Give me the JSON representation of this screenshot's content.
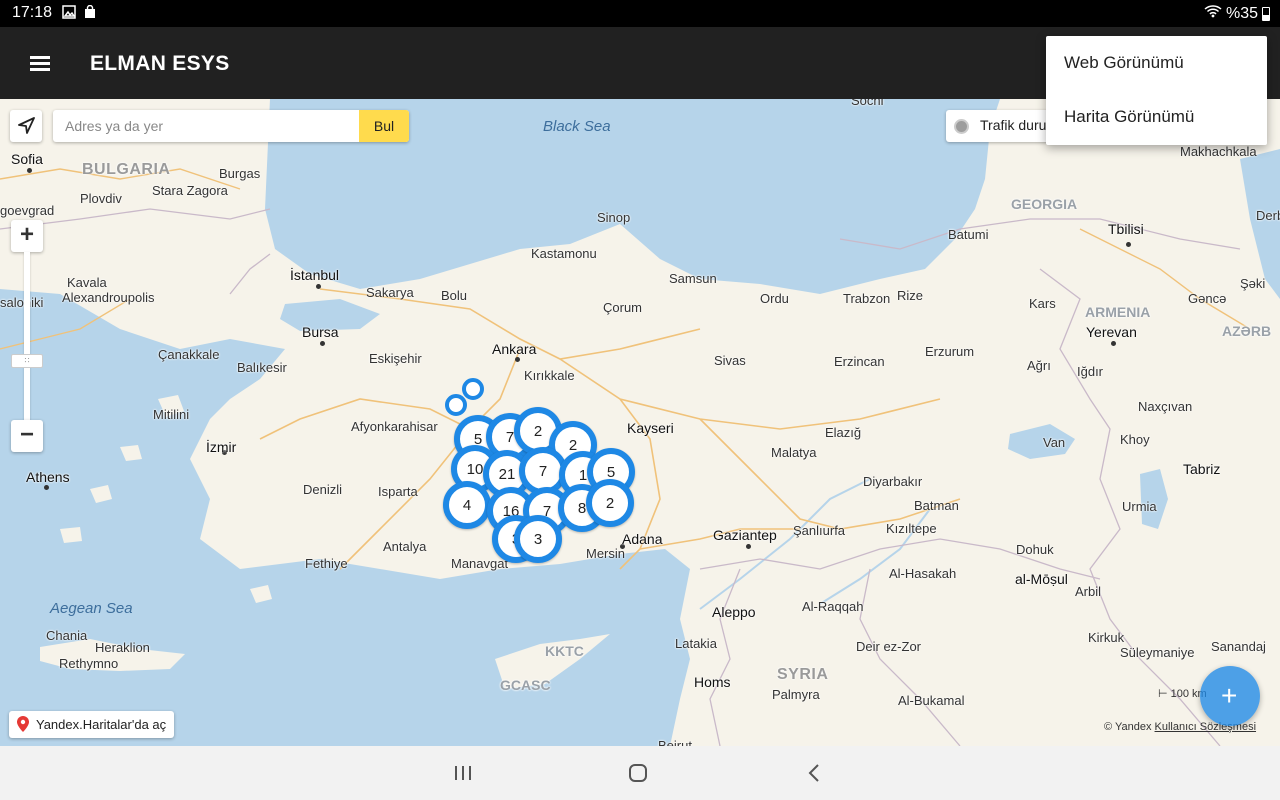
{
  "status_bar": {
    "time": "17:18",
    "battery": "%35",
    "icons": [
      "gallery-icon",
      "shopping-bag-icon",
      "wifi-icon",
      "battery-icon"
    ]
  },
  "app_bar": {
    "title": "ELMAN ESYS",
    "menu_icon": "hamburger-menu-icon"
  },
  "menu": {
    "items": [
      {
        "label": "Web Görünümü"
      },
      {
        "label": "Harita Görünümü"
      }
    ]
  },
  "search": {
    "placeholder": "Adres ya da yer",
    "button": "Bul"
  },
  "traffic": {
    "label": "Trafik duru"
  },
  "map_controls": {
    "zoom_in": "+",
    "zoom_out": "−"
  },
  "yandex_link": {
    "label": "Yandex.Haritalar'da aç"
  },
  "scale": {
    "label": "100 km"
  },
  "copyright": {
    "prefix": "© Yandex",
    "link": "Kullanıcı Sözleşmesi"
  },
  "map_labels": {
    "seas": [
      "Black Sea",
      "Aegean Sea"
    ],
    "countries": [
      "BULGARIA",
      "GEORGIA",
      "ARMENIA",
      "AZƏRB",
      "SYRIA"
    ],
    "regions": [
      "KKTC",
      "GCASC"
    ],
    "cities": [
      "Sofia",
      "Burgas",
      "Stara Zagora",
      "Plovdiv",
      "goevgrad",
      "Kavala",
      "Alexandroupolis",
      "saloniki",
      "İstanbul",
      "Sakarya",
      "Bolu",
      "Kastamonu",
      "Sinop",
      "Samsun",
      "Ordu",
      "Trabzon",
      "Rize",
      "Batumi",
      "Tbilisi",
      "Makhachkala",
      "Derb",
      "Şəki",
      "Gəncə",
      "Kars",
      "Yerevan",
      "Bursa",
      "Çanakkale",
      "Balıkesir",
      "Eskişehir",
      "Ankara",
      "Kırıkkale",
      "Çorum",
      "Sivas",
      "Erzincan",
      "Erzurum",
      "Ağrı",
      "Iğdır",
      "Naxçıvan",
      "Mitilini",
      "Afyonkarahisar",
      "Kayseri",
      "Elazığ",
      "Malatya",
      "Van",
      "Khoy",
      "İzmir",
      "Athens",
      "Denizli",
      "Isparta",
      "Diyarbakır",
      "Batman",
      "Tabriz",
      "Urmia",
      "Antalya",
      "Fethiye",
      "Manavgat",
      "Mersin",
      "Adana",
      "Gaziantep",
      "Şanlıurfa",
      "Kızıltepe",
      "Dohuk",
      "Al-Hasakah",
      "al-Mōṣul",
      "Arbil",
      "Aleppo",
      "Al-Raqqah",
      "Latakia",
      "Deir ez-Zor",
      "Kirkuk",
      "Süleymaniye",
      "Sanandaj",
      "Homs",
      "Palmyra",
      "Al-Bukamal",
      "Chania",
      "Heraklion",
      "Rethymno",
      "Sochi",
      "Beirut"
    ]
  },
  "clusters": [
    {
      "count": "5"
    },
    {
      "count": "7"
    },
    {
      "count": "2"
    },
    {
      "count": "2"
    },
    {
      "count": "10"
    },
    {
      "count": "21"
    },
    {
      "count": "7"
    },
    {
      "count": "1"
    },
    {
      "count": "5"
    },
    {
      "count": "4"
    },
    {
      "count": "16"
    },
    {
      "count": "7"
    },
    {
      "count": "8"
    },
    {
      "count": "2"
    },
    {
      "count": "3"
    },
    {
      "count": "3"
    }
  ],
  "fab": {
    "icon": "add-icon"
  },
  "nav_bar": {
    "icons": [
      "recents-icon",
      "home-icon",
      "back-icon"
    ]
  },
  "colors": {
    "accent": "#1e88e5",
    "search_button": "#ffdb4d",
    "app_bar": "#212121",
    "sea": "#b6d4ea",
    "land": "#f6f3ea"
  }
}
